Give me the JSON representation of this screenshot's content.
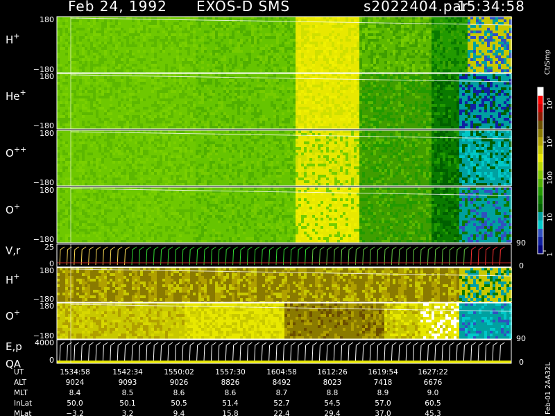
{
  "header": {
    "date": "Feb 24, 1992",
    "instrument": "EXOS-D SMS",
    "file": "s2022404.par",
    "time": "15:34:58"
  },
  "panels": [
    {
      "id": "hplus_top",
      "label_main": "H",
      "label_sup": "+",
      "ytick_top": "180",
      "ytick_bottom": "−180",
      "scheme": "h1"
    },
    {
      "id": "heplus",
      "label_main": "He",
      "label_sup": "+",
      "ytick_top": "180",
      "ytick_bottom": "−180",
      "scheme": "he"
    },
    {
      "id": "oplusplus",
      "label_main": "O",
      "label_sup": "++",
      "ytick_top": "180",
      "ytick_bottom": "−180",
      "scheme": "o2"
    },
    {
      "id": "oplus_top",
      "label_main": "O",
      "label_sup": "+",
      "ytick_top": "180",
      "ytick_bottom": "−180",
      "scheme": "o1"
    },
    {
      "id": "vr",
      "label_main": "V,r",
      "label_sup": "",
      "ytick_top": "25",
      "ytick_bottom": "0",
      "right_top": "90",
      "right_bottom": "0",
      "scheme": "line"
    },
    {
      "id": "hplus_low",
      "label_main": "H",
      "label_sup": "+",
      "ytick_top": "180",
      "ytick_bottom": "−180",
      "scheme": "h2"
    },
    {
      "id": "oplus_low",
      "label_main": "O",
      "label_sup": "+",
      "ytick_top": "180",
      "ytick_bottom": "−180",
      "scheme": "o3"
    },
    {
      "id": "ep",
      "label_main": "E,p",
      "label_sub": "QA",
      "ytick_top": "4000",
      "ytick_bottom": "0",
      "right_top": "90",
      "right_bottom": "0",
      "scheme": "line2"
    }
  ],
  "colorbar": {
    "unit": "Ct/Smp",
    "tick_labels": [
      "10⁴",
      "10³",
      "100",
      "10",
      "1"
    ],
    "right_label": "Feb-01 2AA32L",
    "colors": [
      "#ffffff",
      "#ff0000",
      "#cc0000",
      "#8b1a00",
      "#6b4e00",
      "#8a7a00",
      "#b0a000",
      "#c8c800",
      "#e8e800",
      "#b8d800",
      "#80c800",
      "#50b000",
      "#229a00",
      "#0a7a00",
      "#006000",
      "#00a0a0",
      "#00c8c8",
      "#3050c0",
      "#1020a0",
      "#00007a"
    ]
  },
  "chart_data": {
    "type": "heatmap",
    "title": "Feb 24, 1992   EXOS-D SMS",
    "x_ticks": [
      "1534:58",
      "1542:34",
      "1550:02",
      "1557:30",
      "1604:58",
      "1612:26",
      "1619:54",
      "1627:22"
    ],
    "y_range_pitch": [
      -180,
      180
    ],
    "series": [
      {
        "name": "H+",
        "ylim": [
          -180,
          180
        ]
      },
      {
        "name": "He+",
        "ylim": [
          -180,
          180
        ]
      },
      {
        "name": "O++",
        "ylim": [
          -180,
          180
        ]
      },
      {
        "name": "O+",
        "ylim": [
          -180,
          180
        ]
      },
      {
        "name": "V,r",
        "ylim": [
          0,
          25
        ],
        "right_ylim": [
          0,
          90
        ]
      },
      {
        "name": "H+",
        "ylim": [
          -180,
          180
        ]
      },
      {
        "name": "O+",
        "ylim": [
          -180,
          180
        ]
      },
      {
        "name": "E,p",
        "ylim": [
          0,
          4000
        ],
        "right_ylim": [
          0,
          90
        ]
      }
    ],
    "colorbar_range": [
      "1",
      "10⁴"
    ]
  },
  "table": {
    "rows": [
      {
        "label": "UT",
        "values": [
          "1534:58",
          "1542:34",
          "1550:02",
          "1557:30",
          "1604:58",
          "1612:26",
          "1619:54",
          "1627:22"
        ]
      },
      {
        "label": "ALT",
        "values": [
          "9024",
          "9093",
          "9026",
          "8826",
          "8492",
          "8023",
          "7418",
          "6676"
        ]
      },
      {
        "label": "MLT",
        "values": [
          "8.4",
          "8.5",
          "8.6",
          "8.6",
          "8.7",
          "8.8",
          "8.9",
          "9.0"
        ]
      },
      {
        "label": "InLat",
        "values": [
          "50.0",
          "50.1",
          "50.5",
          "51.4",
          "52.7",
          "54.5",
          "57.0",
          "60.5"
        ]
      },
      {
        "label": "MLat",
        "values": [
          "−3.2",
          "3.2",
          "9.4",
          "15.8",
          "22.4",
          "29.4",
          "37.0",
          "45.3"
        ]
      }
    ]
  }
}
